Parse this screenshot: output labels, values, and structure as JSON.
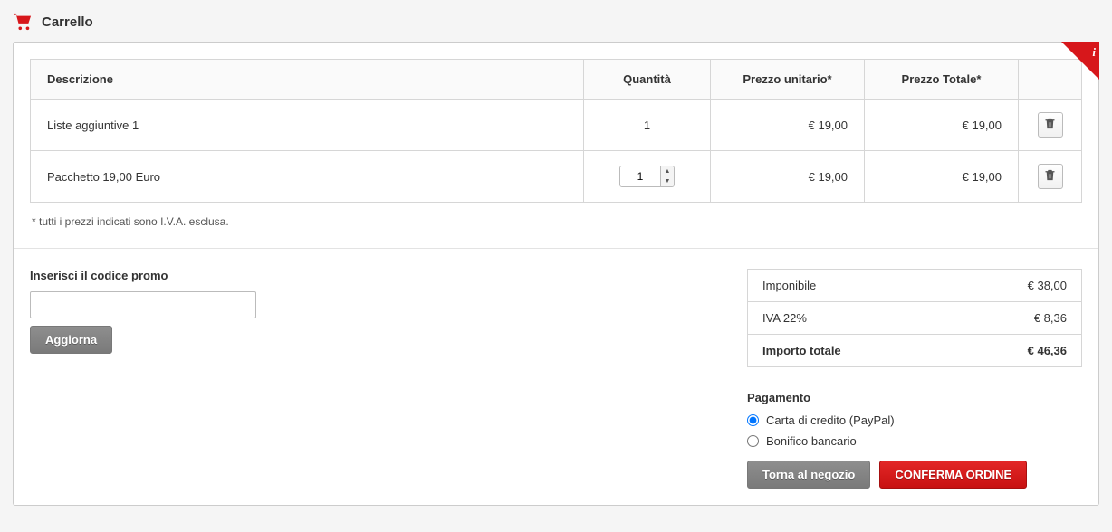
{
  "page_title": "Carrello",
  "table": {
    "headers": {
      "description": "Descrizione",
      "quantity": "Quantità",
      "unit_price": "Prezzo unitario*",
      "total_price": "Prezzo Totale*"
    },
    "rows": [
      {
        "description": "Liste aggiuntive 1",
        "qty": "1",
        "qty_editable": false,
        "unit": "€ 19,00",
        "total": "€ 19,00"
      },
      {
        "description": "Pacchetto 19,00 Euro",
        "qty": "1",
        "qty_editable": true,
        "unit": "€ 19,00",
        "total": "€ 19,00"
      }
    ]
  },
  "price_note": "* tutti i prezzi indicati sono I.V.A. esclusa.",
  "promo": {
    "label": "Inserisci il codice promo",
    "value": "",
    "update_label": "Aggiorna"
  },
  "totals": {
    "taxable_label": "Imponibile",
    "taxable_value": "€ 38,00",
    "vat_label": "IVA 22%",
    "vat_value": "€ 8,36",
    "grand_label": "Importo totale",
    "grand_value": "€ 46,36"
  },
  "payment": {
    "heading": "Pagamento",
    "options": [
      {
        "label": "Carta di credito (PayPal)",
        "checked": true
      },
      {
        "label": "Bonifico bancario",
        "checked": false
      }
    ]
  },
  "actions": {
    "back": "Torna al negozio",
    "confirm": "CONFERMA ORDINE"
  }
}
